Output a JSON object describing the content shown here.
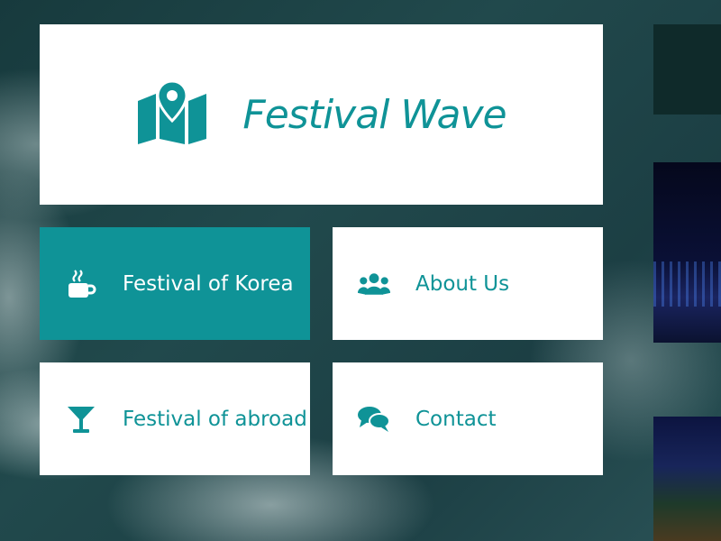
{
  "brand": {
    "title": "Festival Wave",
    "icon": "map-marker-icon"
  },
  "colors": {
    "accent": "#0f9397",
    "card": "#ffffff"
  },
  "menu": [
    {
      "label": "Festival of Korea",
      "icon": "coffee-cup-icon",
      "active": true
    },
    {
      "label": "About Us",
      "icon": "users-icon",
      "active": false
    },
    {
      "label": "Festival of abroad",
      "icon": "cocktail-glass-icon",
      "active": false
    },
    {
      "label": "Contact",
      "icon": "chat-bubbles-icon",
      "active": false
    }
  ]
}
